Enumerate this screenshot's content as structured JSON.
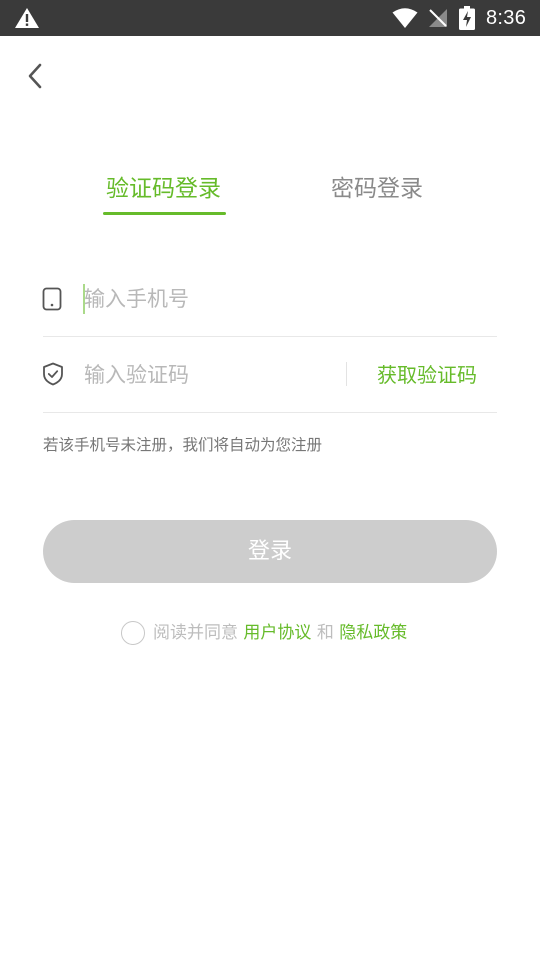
{
  "status_bar": {
    "time": "8:36",
    "icons": [
      "warning-icon",
      "wifi-icon",
      "no-signal-icon",
      "battery-charging-icon"
    ]
  },
  "tabs": {
    "sms_login": "验证码登录",
    "password_login": "密码登录",
    "active": "sms_login"
  },
  "form": {
    "phone_placeholder": "输入手机号",
    "code_placeholder": "输入验证码",
    "get_code_label": "获取验证码",
    "hint": "若该手机号未注册，我们将自动为您注册"
  },
  "login_button": "登录",
  "agreement": {
    "prefix": "阅读并同意",
    "user_agreement": "用户协议",
    "and": "和",
    "privacy_policy": "隐私政策",
    "checked": false
  },
  "colors": {
    "accent": "#66bb2a",
    "disabled_button": "#cdcdcd",
    "status_bar": "#3a3a3a"
  }
}
